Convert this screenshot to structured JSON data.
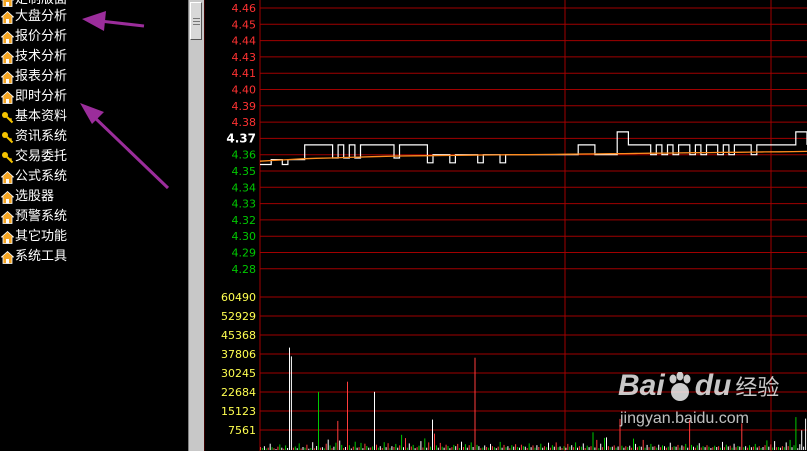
{
  "sidebar": {
    "top_partial_label": "定制版面",
    "items": [
      {
        "label": "大盘分析",
        "icon": "house-icon"
      },
      {
        "label": "报价分析",
        "icon": "house-icon"
      },
      {
        "label": "技术分析",
        "icon": "house-icon"
      },
      {
        "label": "报表分析",
        "icon": "house-icon"
      },
      {
        "label": "即时分析",
        "icon": "house-icon"
      },
      {
        "label": "基本资料",
        "icon": "key-icon"
      },
      {
        "label": "资讯系统",
        "icon": "key-icon"
      },
      {
        "label": "交易委托",
        "icon": "key-icon"
      },
      {
        "label": "公式系统",
        "icon": "house-icon"
      },
      {
        "label": "选股器",
        "icon": "house-icon"
      },
      {
        "label": "预警系统",
        "icon": "house-icon"
      },
      {
        "label": "其它功能",
        "icon": "house-icon"
      },
      {
        "label": "系统工具",
        "icon": "house-icon"
      }
    ]
  },
  "watermark": {
    "brand_left": "Bai",
    "brand_right": "du",
    "brand_cn": "经验",
    "url": "jingyan.baidu.com"
  },
  "colors": {
    "price_axis_label": "#ff3232",
    "current_price_label": "#ffffff",
    "below_price_label": "#00c800",
    "volume_axis_label": "#ffff50",
    "grid": "#a00000",
    "price_line": "#ffffff",
    "average_line": "#ff8c1e",
    "annotation_arrow": "#9b2d9b"
  },
  "chart_data": [
    {
      "type": "line",
      "title": "",
      "price_ticks": [
        "4.46",
        "4.45",
        "4.44",
        "4.43",
        "4.41",
        "4.40",
        "4.39",
        "4.38",
        "4.37",
        "4.36",
        "4.35",
        "4.34",
        "4.33",
        "4.32",
        "4.30",
        "4.29",
        "4.28"
      ],
      "current_price": "4.37",
      "series": [
        {
          "values": [
            4.364,
            4.364,
            4.367,
            4.367,
            4.364,
            4.367,
            4.367,
            4.367,
            4.376,
            4.376,
            4.376,
            4.376,
            4.376,
            4.368,
            4.376,
            4.368,
            4.376,
            4.368,
            4.376,
            4.376,
            4.376,
            4.376,
            4.376,
            4.376,
            4.368,
            4.376,
            4.376,
            4.376,
            4.376,
            4.376,
            4.365,
            4.37,
            4.37,
            4.37,
            4.365,
            4.37,
            4.37,
            4.37,
            4.37,
            4.365,
            4.37,
            4.37,
            4.37,
            4.365,
            4.37,
            4.37,
            4.37,
            4.37,
            4.37,
            4.37,
            4.37,
            4.37,
            4.37,
            4.37,
            4.37,
            4.37,
            4.37,
            4.376,
            4.376,
            4.376,
            4.37,
            4.37,
            4.37,
            4.37,
            4.384,
            4.384,
            4.376,
            4.376,
            4.376,
            4.376,
            4.37,
            4.376,
            4.37,
            4.376,
            4.37,
            4.376,
            4.376,
            4.37,
            4.376,
            4.37,
            4.376,
            4.376,
            4.37,
            4.376,
            4.37,
            4.376,
            4.376,
            4.376,
            4.37,
            4.376,
            4.376,
            4.376,
            4.376,
            4.376,
            4.376,
            4.376,
            4.384,
            4.384,
            4.376
          ]
        },
        {
          "values": [
            4.366,
            4.3665,
            4.367,
            4.3675,
            4.3678,
            4.368,
            4.3683,
            4.3685,
            4.3688,
            4.369,
            4.3692,
            4.3693,
            4.3694,
            4.3695,
            4.3696,
            4.3697,
            4.3698,
            4.3699,
            4.37,
            4.37,
            4.3701,
            4.3702,
            4.3703,
            4.3704,
            4.3705,
            4.3706,
            4.3707,
            4.3708,
            4.3709,
            4.371,
            4.3711,
            4.3712,
            4.3713,
            4.3714,
            4.3715,
            4.3716,
            4.3717,
            4.3718,
            4.3719,
            4.372
          ]
        }
      ]
    },
    {
      "type": "bar",
      "title": "",
      "volume_ticks": [
        "60490",
        "52929",
        "45368",
        "37806",
        "30245",
        "22684",
        "15123",
        "7561"
      ],
      "ylim": [
        0,
        60490
      ],
      "values": [
        1200,
        800,
        1500,
        600,
        900,
        2500,
        1100,
        700,
        400,
        1300,
        2200,
        900,
        500,
        1800,
        800,
        40500,
        37000,
        900,
        1400,
        700,
        2600,
        600,
        1200,
        900,
        2100,
        500,
        800,
        3100,
        700,
        1600,
        23000,
        900,
        1100,
        650,
        2500,
        4100,
        1800,
        700,
        1300,
        2900,
        11500,
        3700,
        2000,
        750,
        1200,
        27000,
        1900,
        600,
        1300,
        3300,
        900,
        1100,
        2800,
        700,
        2500,
        1600,
        900,
        1000,
        1400,
        23000,
        2100,
        900,
        1500,
        800,
        3100,
        1100,
        2700,
        700,
        1500,
        1200,
        2400,
        900,
        1800,
        6000,
        1100,
        4700,
        900,
        2600,
        1400,
        2000,
        700,
        1100,
        1700,
        3500,
        1000,
        4600,
        900,
        3000,
        1300,
        12000,
        6500,
        1800,
        900,
        2800,
        1300,
        900,
        2100,
        1600,
        700,
        1100,
        2000,
        1500,
        2400,
        800,
        3300,
        1200,
        2300,
        900,
        1900,
        3000,
        1200,
        36500,
        2000,
        1500,
        700,
        1000,
        1800,
        1200,
        900,
        2400,
        1500,
        1100,
        700,
        1300,
        3200,
        900,
        2000,
        1100,
        1500,
        700,
        1900,
        1300,
        2300,
        1200,
        900,
        2100,
        1500,
        1300,
        800,
        2600,
        1100,
        1800,
        900,
        1900,
        1200,
        2500,
        900,
        1500,
        1100,
        2900,
        900,
        1900,
        1300,
        3000,
        1100,
        1400,
        800,
        1500,
        900,
        2400,
        1300,
        1900,
        1100,
        3000,
        900,
        1500,
        1300,
        2600,
        800,
        1700,
        1100,
        1500,
        7000,
        1000,
        4000,
        700,
        2500,
        1100,
        4800,
        5000,
        1500,
        1100,
        1300,
        1800,
        900,
        1400,
        12300,
        1700,
        900,
        1500,
        1200,
        1700,
        900,
        4500,
        2400,
        1100,
        1500,
        1300,
        4000,
        900,
        2000,
        1100,
        2400,
        1300,
        1500,
        900,
        2100,
        1100,
        1800,
        1500,
        900,
        1300,
        2900,
        1100,
        1500,
        1300,
        2000,
        900,
        1800,
        1400,
        2400,
        900,
        12000,
        2000,
        1300,
        900,
        1800,
        2700,
        1000,
        1500,
        1100,
        1900,
        1300,
        800,
        1100,
        1700,
        1200,
        1500,
        900,
        3200,
        1100,
        2100,
        1400,
        1700,
        900,
        2500,
        1100,
        1600,
        1300,
        10500,
        1100,
        1500,
        900,
        1900,
        1100,
        1300,
        2400,
        1000,
        1500,
        800,
        1200,
        1900,
        3800,
        1300,
        2200,
        1000,
        3500,
        1100,
        1200,
        900,
        1500,
        1100,
        3000,
        1500,
        4000,
        1100,
        1900,
        13000,
        700,
        2300,
        7800,
        1300,
        12400
      ],
      "colors": [
        "r",
        "g",
        "w",
        "g",
        "r",
        "w",
        "g",
        "r",
        "w",
        "r",
        "g",
        "w",
        "r",
        "g",
        "w",
        "w",
        "w",
        "r",
        "g",
        "w",
        "g",
        "r",
        "w",
        "g",
        "r",
        "w",
        "g",
        "w",
        "r",
        "w",
        "g",
        "r",
        "w",
        "g",
        "r",
        "w",
        "g",
        "r",
        "w",
        "g",
        "r",
        "w",
        "g",
        "r",
        "w",
        "r",
        "g",
        "w",
        "r",
        "g",
        "w",
        "r",
        "g",
        "w",
        "r",
        "g",
        "w",
        "r",
        "g",
        "w",
        "r",
        "g",
        "w",
        "r",
        "g",
        "w",
        "r",
        "g",
        "w",
        "r",
        "g",
        "w",
        "r",
        "g",
        "w",
        "r",
        "g",
        "w",
        "r",
        "g",
        "w",
        "r",
        "g",
        "w",
        "r",
        "g",
        "w",
        "r",
        "g",
        "w",
        "r",
        "g",
        "w",
        "r",
        "g",
        "w",
        "r",
        "g",
        "w",
        "r",
        "g",
        "w",
        "r",
        "g",
        "w",
        "r",
        "g",
        "w",
        "r",
        "g",
        "w",
        "r",
        "g",
        "w",
        "r",
        "g",
        "w",
        "r",
        "g",
        "w",
        "r",
        "g",
        "w",
        "r",
        "g",
        "w",
        "r",
        "g",
        "w",
        "r",
        "g",
        "w",
        "r",
        "g",
        "w",
        "r",
        "g",
        "w",
        "r",
        "g",
        "w",
        "r",
        "g",
        "w",
        "r",
        "g",
        "w",
        "r",
        "g",
        "w",
        "r",
        "g",
        "w",
        "r",
        "g",
        "w",
        "r",
        "g",
        "w",
        "r",
        "g",
        "w",
        "r",
        "g",
        "w",
        "r",
        "g",
        "w",
        "r",
        "g",
        "w",
        "r",
        "g",
        "w",
        "r",
        "g",
        "w",
        "r",
        "g",
        "w",
        "r",
        "g",
        "w",
        "r",
        "g",
        "w",
        "r",
        "g",
        "w",
        "r",
        "g",
        "w",
        "r",
        "g",
        "w",
        "r",
        "g",
        "w",
        "r",
        "g",
        "w",
        "r",
        "g",
        "w",
        "r",
        "g",
        "w",
        "r",
        "g",
        "w",
        "r",
        "g",
        "w",
        "r",
        "g",
        "w",
        "r",
        "g",
        "w",
        "r",
        "g",
        "w",
        "r",
        "g",
        "w",
        "r",
        "g",
        "w",
        "r",
        "g",
        "w",
        "r",
        "g",
        "w",
        "r",
        "g",
        "w",
        "r",
        "g",
        "w",
        "r",
        "g",
        "w",
        "r",
        "g",
        "w",
        "r",
        "g",
        "w",
        "r",
        "g",
        "w",
        "r",
        "g",
        "w",
        "r",
        "g",
        "w",
        "r",
        "g",
        "w",
        "r",
        "g",
        "w",
        "r",
        "g",
        "w",
        "r",
        "g",
        "w",
        "r",
        "g",
        "w",
        "r",
        "g",
        "w",
        "g",
        "g"
      ]
    }
  ]
}
